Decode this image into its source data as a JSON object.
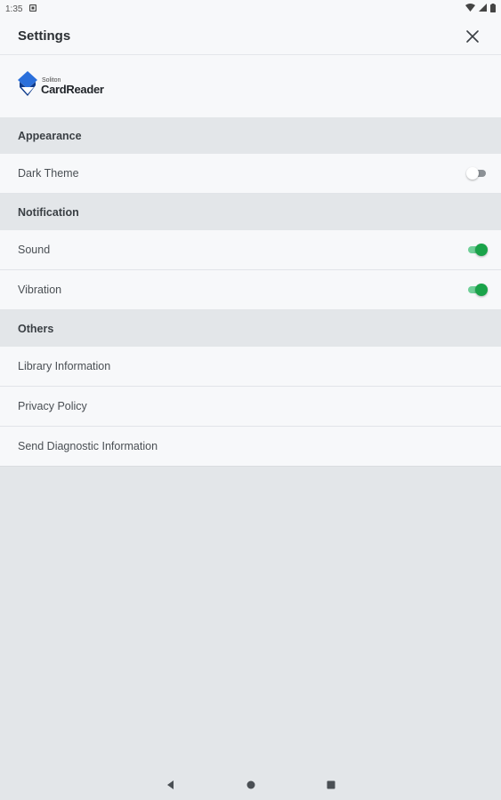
{
  "status_bar": {
    "time": "1:35",
    "icons": [
      "notification-icon",
      "wifi-icon",
      "signal-icon",
      "battery-icon"
    ]
  },
  "app_bar": {
    "title": "Settings",
    "close_icon": "close-icon"
  },
  "logo": {
    "brand_small": "Soliton",
    "brand_name": "CardReader",
    "colors": {
      "primary": "#2a6fdb",
      "secondary": "#0d3a8c"
    }
  },
  "sections": {
    "appearance": {
      "header": "Appearance",
      "dark_theme": {
        "label": "Dark Theme",
        "enabled": false
      }
    },
    "notification": {
      "header": "Notification",
      "sound": {
        "label": "Sound",
        "enabled": true
      },
      "vibration": {
        "label": "Vibration",
        "enabled": true
      }
    },
    "others": {
      "header": "Others",
      "library_information": "Library Information",
      "privacy_policy": "Privacy Policy",
      "send_diagnostic": "Send Diagnostic Information"
    }
  },
  "colors": {
    "toggle_on_thumb": "#1aa34a",
    "toggle_on_track": "#6fcf97",
    "toggle_off_track": "#8c9196",
    "section_bg": "#e3e6e9",
    "row_bg": "#f7f8fa"
  },
  "nav_bar": {
    "icons": [
      "back-icon",
      "home-icon",
      "recents-icon"
    ]
  }
}
